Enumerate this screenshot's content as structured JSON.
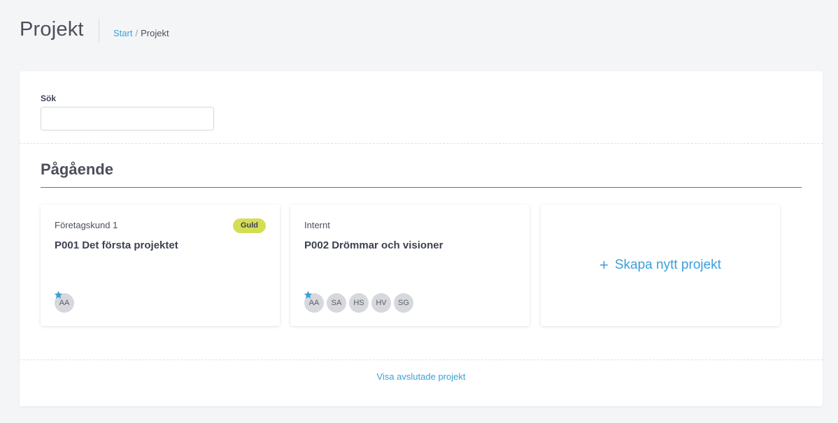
{
  "header": {
    "title": "Projekt",
    "breadcrumb": {
      "home": "Start",
      "separator": "/",
      "current": "Projekt"
    }
  },
  "search": {
    "label": "Sök",
    "value": "",
    "placeholder": ""
  },
  "section": {
    "title": "Pågående"
  },
  "projects": [
    {
      "client": "Företagskund 1",
      "title": "P001 Det första projektet",
      "badge": "Guld",
      "members": [
        "AA"
      ]
    },
    {
      "client": "Internt",
      "title": "P002 Drömmar och visioner",
      "badge": "",
      "members": [
        "AA",
        "SA",
        "HS",
        "HV",
        "SG"
      ]
    }
  ],
  "create": {
    "plus": "+",
    "label": "Skapa nytt projekt"
  },
  "footer": {
    "show_finished": "Visa avslutade projekt"
  },
  "colors": {
    "accent": "#3aa0d8",
    "badge_gold": "#d4de55",
    "avatar_bg": "#d6d8dc",
    "star": "#3aa0d8"
  },
  "icons": {
    "favorite": "star-icon",
    "create": "plus-icon"
  }
}
